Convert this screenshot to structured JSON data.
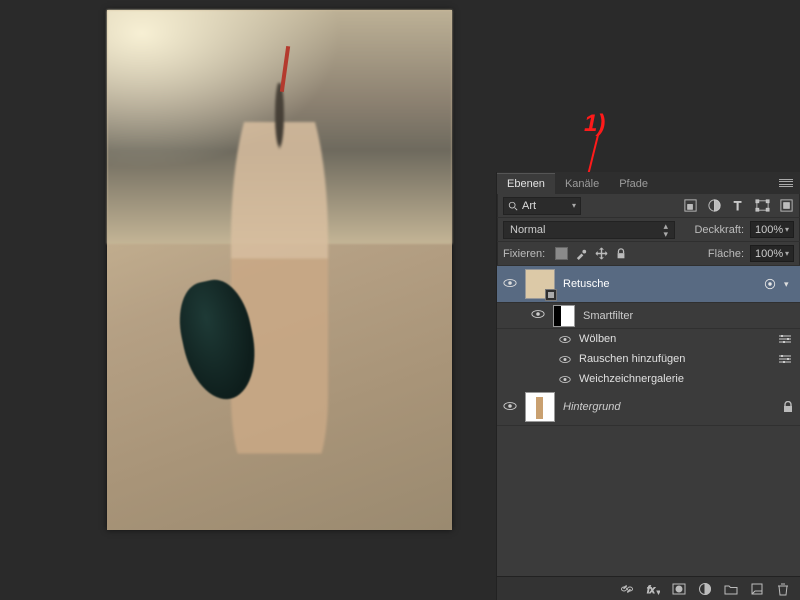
{
  "annotation": {
    "label": "1)"
  },
  "panel": {
    "tabs": [
      "Ebenen",
      "Kanäle",
      "Pfade"
    ],
    "active_tab": 0,
    "search_label": "Art",
    "blend_mode": "Normal",
    "opacity_label": "Deckkraft:",
    "opacity_value": "100%",
    "lock_label": "Fixieren:",
    "fill_label": "Fläche:",
    "fill_value": "100%"
  },
  "layers": [
    {
      "name": "Retusche",
      "selected": true,
      "smart_object": true,
      "expanded": true,
      "smartfilter_label": "Smartfilter",
      "filters": [
        {
          "name": "Wölben",
          "has_settings": true
        },
        {
          "name": "Rauschen hinzufügen",
          "has_settings": true
        },
        {
          "name": "Weichzeichnergalerie",
          "has_settings": false
        }
      ]
    },
    {
      "name": "Hintergrund",
      "locked": true
    }
  ]
}
